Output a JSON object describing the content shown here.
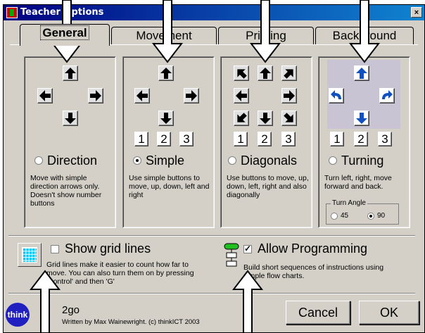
{
  "window": {
    "title": "Teacher Options",
    "close_label": "×"
  },
  "tabs": [
    {
      "label": "General"
    },
    {
      "label": "Movement"
    },
    {
      "label": "Printing"
    },
    {
      "label": "Background"
    }
  ],
  "numbers": [
    "1",
    "2",
    "3"
  ],
  "options": {
    "direction": {
      "label": "Direction",
      "selected": false,
      "description": "Move with simple direction arrows only. Doesn't show number buttons"
    },
    "simple": {
      "label": "Simple",
      "selected": true,
      "description": "Use simple buttons to move, up, down, left and right"
    },
    "diagonals": {
      "label": "Diagonals",
      "selected": false,
      "description": "Use buttons to move, up, down, left, right and also diagonally"
    },
    "turning": {
      "label": "Turning",
      "selected": false,
      "description": "Turn left, right, move forward and back.",
      "turn_angle": {
        "legend": "Turn Angle",
        "options": [
          "45",
          "90"
        ],
        "selected": "90"
      }
    }
  },
  "grid_lines": {
    "label": "Show grid lines",
    "checked": false,
    "description": "Grid lines make it easier to count how far to move. You can also turn them on by pressing 'Control' and then 'G'"
  },
  "programming": {
    "label": "Allow Programming",
    "checked": true,
    "description": "Build short sequences of instructions using simple flow charts."
  },
  "footer": {
    "logo_text": "think",
    "app_name": "2go",
    "credit": "Written by Max Wainewright. (c) thinkICT 2003"
  },
  "buttons": {
    "cancel": "Cancel",
    "ok": "OK"
  },
  "icons": [
    "up-arrow-icon",
    "down-arrow-icon",
    "left-arrow-icon",
    "right-arrow-icon",
    "diagonal-arrow-icon",
    "turn-left-icon",
    "turn-right-icon",
    "grid-icon",
    "flowchart-icon",
    "pointer-arrow-icon"
  ],
  "colors": {
    "titlebar": "#000080",
    "dialog": "#d4d0c8",
    "turn_arrow": "#1050c0",
    "flow_green": "#20c020",
    "grid_cyan": "#00c8ff"
  }
}
